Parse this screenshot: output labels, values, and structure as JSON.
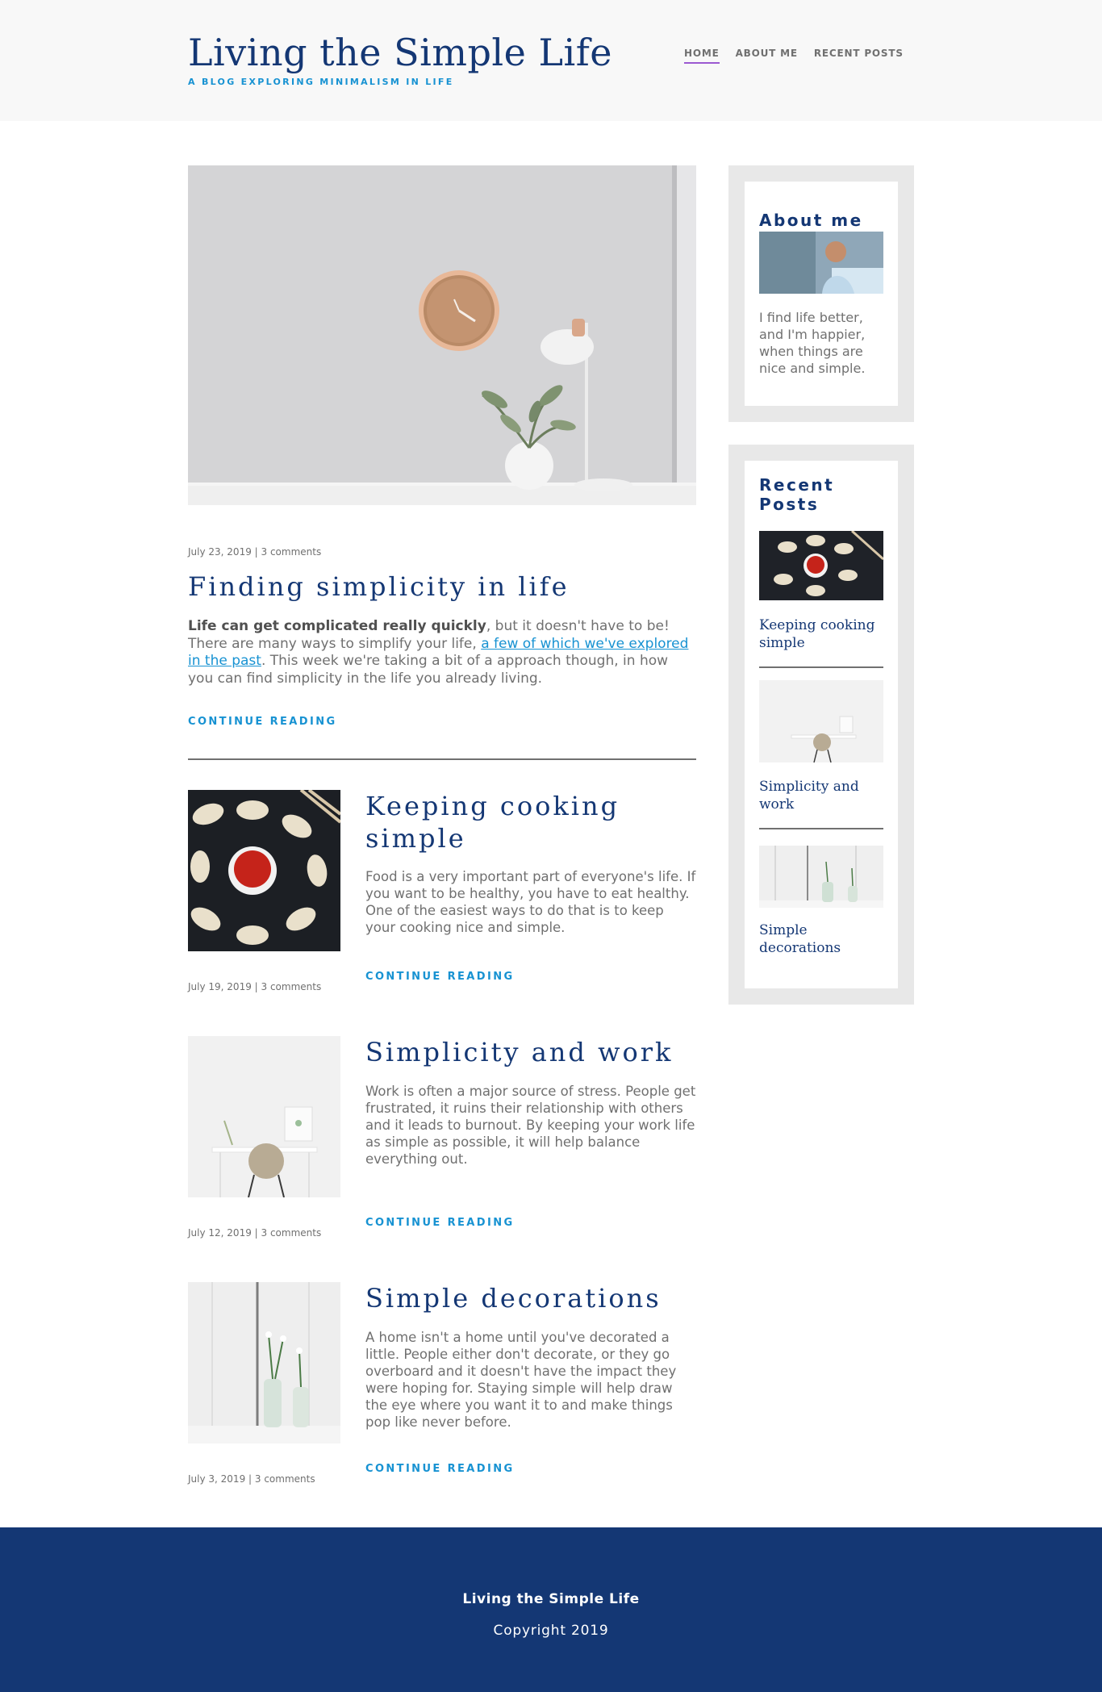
{
  "header": {
    "title": "Living the Simple Life",
    "tagline": "A blog exploring minimalism in life",
    "nav": [
      {
        "label": "HOME",
        "active": true
      },
      {
        "label": "ABOUT ME",
        "active": false
      },
      {
        "label": "RECENT POSTS",
        "active": false
      }
    ]
  },
  "featured": {
    "meta": "July 23, 2019 | 3 comments",
    "title": "Finding simplicity in life",
    "excerpt_bold": "Life can get complicated really quickly",
    "excerpt_part1": ", but it doesn't have to be! There are many ways to simplify your life, ",
    "excerpt_link": "a few of which we've explored in the past",
    "excerpt_part2": ". This week we're taking a bit of a approach though, in how you can find simplicity in the life you already living.",
    "continue": "CONTINUE READING"
  },
  "posts": [
    {
      "title": "Keeping cooking simple",
      "excerpt": "Food is a very important part of everyone's life. If you want to be healthy, you have to eat healthy. One of the easiest ways to do that is to keep your cooking nice and simple.",
      "meta": "July 19, 2019 | 3 comments",
      "continue": "CONTINUE READING"
    },
    {
      "title": "Simplicity and work",
      "excerpt": "Work is often a major source of stress. People get frustrated, it ruins their relationship with others and it leads to burnout. By keeping your work life as simple as possible, it will help balance everything out.",
      "meta": "July 12, 2019 | 3 comments",
      "continue": "CONTINUE READING"
    },
    {
      "title": "Simple decorations",
      "excerpt": "A home isn't a home until you've decorated a little. People either don't decorate, or they go overboard and it doesn't have the impact they were hoping for. Staying simple will help draw the eye where you want it to and make things pop like never before.",
      "meta": "July 3, 2019 | 3 comments",
      "continue": "CONTINUE READING"
    }
  ],
  "sidebar": {
    "about": {
      "title": "About me",
      "text": "I find life better, and I'm happier, when things are nice and simple."
    },
    "recent": {
      "title_line1": "Recent",
      "title_line2": "Posts",
      "items": [
        {
          "line1": "Keeping cooking",
          "line2": "simple"
        },
        {
          "line1": "Simplicity and",
          "line2": "work"
        },
        {
          "line1": "Simple",
          "line2": "decorations"
        }
      ]
    }
  },
  "footer": {
    "title": "Living the Simple Life",
    "copyright": "Copyright 2019"
  },
  "colors": {
    "brand": "#143774",
    "accent": "#1792d2",
    "nav_active": "#9b59d1",
    "text": "#707070"
  }
}
